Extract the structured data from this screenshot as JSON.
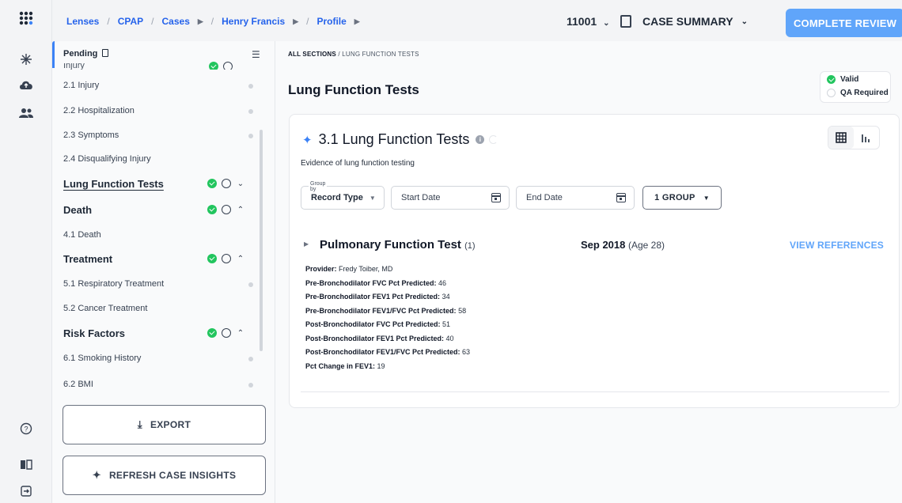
{
  "breadcrumb": [
    "Lenses",
    "CPAP",
    "Cases",
    "Henry Francis",
    "Profile"
  ],
  "header": {
    "case_id": "11001",
    "case_summary_label": "CASE SUMMARY",
    "complete_button": "COMPLETE REVIEW"
  },
  "sidebar": {
    "pending_label": "Pending",
    "cut_item": "Injury",
    "items_injury": [
      "2.1 Injury",
      "2.2 Hospitalization",
      "2.3 Symptoms",
      "2.4 Disqualifying Injury"
    ],
    "sections": [
      {
        "label": "Lung Function Tests",
        "items": []
      },
      {
        "label": "Death",
        "items": [
          "4.1 Death"
        ]
      },
      {
        "label": "Treatment",
        "items": [
          "5.1 Respiratory Treatment",
          "5.2 Cancer Treatment"
        ]
      },
      {
        "label": "Risk Factors",
        "items": [
          "6.1 Smoking History",
          "6.2 BMI"
        ]
      }
    ],
    "export_label": "EXPORT",
    "refresh_label": "REFRESH CASE INSIGHTS"
  },
  "main": {
    "crumb_root": "ALL SECTIONS",
    "crumb_current": "LUNG FUNCTION TESTS",
    "title": "Lung Function Tests",
    "status_valid": "Valid",
    "status_qa": "QA Required",
    "card": {
      "title": "3.1 Lung Function Tests",
      "subtitle": "Evidence of lung function testing",
      "group_by_label": "Group by",
      "record_type_label": "Record Type",
      "start_date_placeholder": "Start Date",
      "end_date_placeholder": "End Date",
      "group_button": "1 GROUP"
    },
    "record": {
      "title": "Pulmonary Function Test",
      "count": "(1)",
      "date": "Sep 2018",
      "age": "(Age 28)",
      "view_refs": "VIEW REFERENCES",
      "fields": [
        {
          "label": "Provider:",
          "value": "Fredy Toiber, MD"
        },
        {
          "label": "Pre-Bronchodilator FVC Pct Predicted:",
          "value": "46"
        },
        {
          "label": "Pre-Bronchodilator FEV1 Pct Predicted:",
          "value": "34"
        },
        {
          "label": "Pre-Bronchodilator FEV1/FVC Pct Predicted:",
          "value": "58"
        },
        {
          "label": "Post-Bronchodilator FVC Pct Predicted:",
          "value": "51"
        },
        {
          "label": "Post-Bronchodilator FEV1 Pct Predicted:",
          "value": "40"
        },
        {
          "label": "Post-Bronchodilator FEV1/FVC Pct Predicted:",
          "value": "63"
        },
        {
          "label": "Pct Change in FEV1:",
          "value": "19"
        }
      ]
    }
  },
  "colors": {
    "accent": "#3b82f6",
    "complete_button": "#60a5fa",
    "valid_green": "#22c55e"
  },
  "icons": {
    "rail": [
      "app-grid-icon",
      "sparkle-icon",
      "cloud-upload-icon",
      "users-icon",
      "help-icon",
      "book-icon",
      "logout-icon"
    ]
  }
}
